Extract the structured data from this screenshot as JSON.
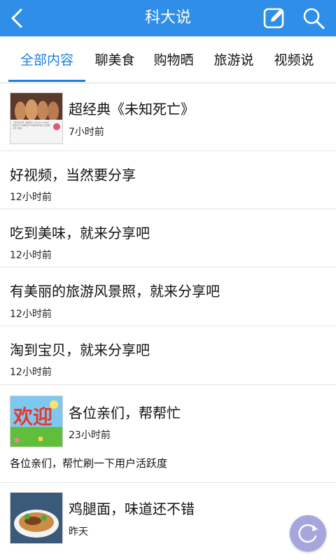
{
  "header": {
    "title": "科大说",
    "back_icon": "back-arrow-icon",
    "edit_icon": "compose-icon",
    "search_icon": "search-icon"
  },
  "tabs": [
    {
      "label": "全部内容",
      "active": true
    },
    {
      "label": "聊美食",
      "active": false
    },
    {
      "label": "购物晒",
      "active": false
    },
    {
      "label": "旅游说",
      "active": false
    },
    {
      "label": "视频说",
      "active": false
    }
  ],
  "feed": [
    {
      "title": "超经典《未知死亡》",
      "time": "7小时前",
      "has_thumb": true,
      "thumb": "movie-poster-thumbnail",
      "thumb_caption": "【高清中字】未知死亡 Ghajini (2008) 阿米尔汗 经典巨作 印度动作电影 完整版 评论 热播"
    },
    {
      "title": "好视频，当然要分享",
      "time": "12小时前",
      "has_thumb": false
    },
    {
      "title": "吃到美味，就来分享吧",
      "time": "12小时前",
      "has_thumb": false
    },
    {
      "title": "有美丽的旅游风景照，就来分享吧",
      "time": "12小时前",
      "has_thumb": false
    },
    {
      "title": "淘到宝贝，就来分享吧",
      "time": "12小时前",
      "has_thumb": false
    },
    {
      "title": "各位亲们，帮帮忙",
      "time": "23小时前",
      "has_thumb": true,
      "thumb": "welcome-banner-thumbnail",
      "thumb_text": "欢迎",
      "desc": "各位亲们，帮忙刷一下用户活跃度"
    },
    {
      "title": "鸡腿面，味道还不错",
      "time": "昨天",
      "has_thumb": true,
      "thumb": "noodle-dish-thumbnail"
    }
  ],
  "fab": {
    "icon": "refresh-icon"
  },
  "colors": {
    "header_bg": "#2f8fe8",
    "tab_active": "#1f7fe0",
    "fab_bg": "#a6a6dc"
  }
}
